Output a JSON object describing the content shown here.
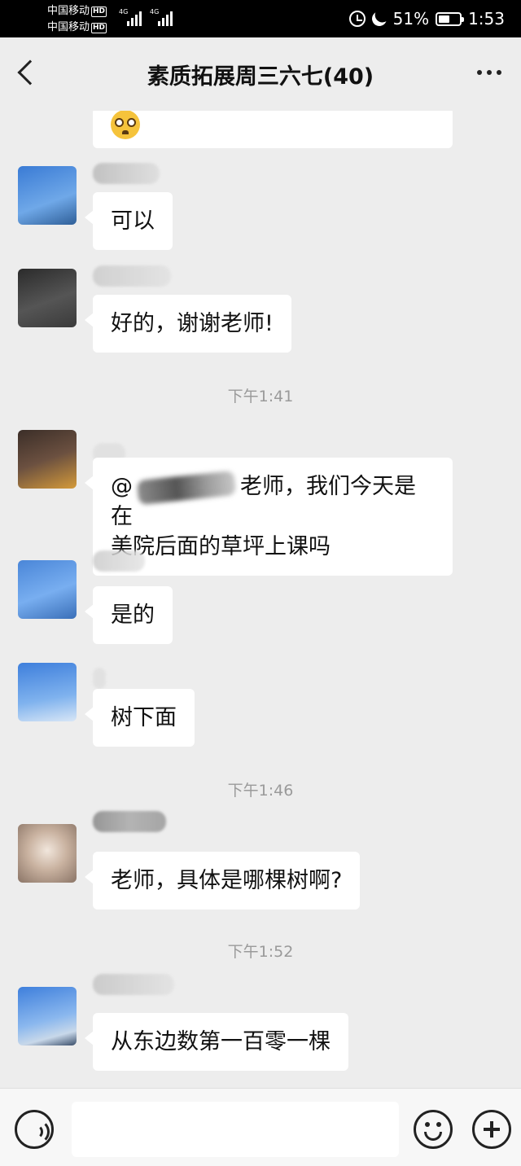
{
  "status_bar": {
    "carrier1": "中国移动",
    "carrier2": "中国移动",
    "hd": "HD",
    "network": "4G",
    "battery": "51%",
    "time": "1:53"
  },
  "header": {
    "title": "素质拓展周三六七(40)"
  },
  "messages": [
    {
      "type": "emoji",
      "icon": "pleading-face-emoji"
    },
    {
      "type": "text",
      "text": "可以"
    },
    {
      "type": "text",
      "text": "好的，谢谢老师!"
    },
    {
      "type": "time",
      "text": "下午1:41"
    },
    {
      "type": "mention",
      "at": "@",
      "line1": "老师，我们今天是在",
      "line2": "美院后面的草坪上课吗"
    },
    {
      "type": "text",
      "text": "是的"
    },
    {
      "type": "text",
      "text": "树下面"
    },
    {
      "type": "time",
      "text": "下午1:46"
    },
    {
      "type": "text",
      "text": "老师，具体是哪棵树啊?"
    },
    {
      "type": "time",
      "text": "下午1:52"
    },
    {
      "type": "text",
      "text": "从东边数第一百零一棵"
    }
  ],
  "input": {
    "value": ""
  },
  "colors": {
    "background": "#ededed",
    "bubble": "#ffffff",
    "status_bar": "#000000"
  }
}
